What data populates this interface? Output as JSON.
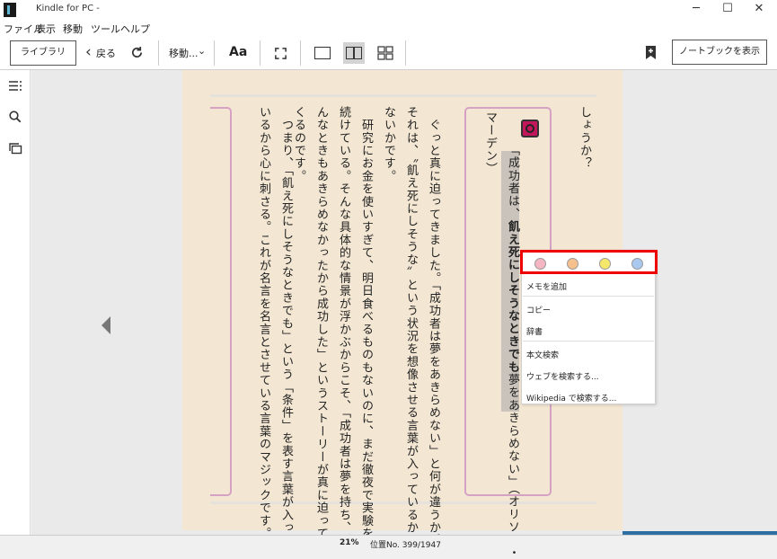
{
  "window": {
    "title": "Kindle for PC -",
    "icon": "kindle-logo-icon",
    "controls": [
      "─",
      "☐",
      "✕"
    ]
  },
  "menubar": {
    "items": [
      "ファイル",
      "表示",
      "移動",
      "ツール",
      "ヘルプ"
    ]
  },
  "toolbar": {
    "library_label": "ライブラリ",
    "back_label": "戻る",
    "goto_label": "移動...",
    "font_label": "Aa",
    "notebook_label": "ノートブックを表示"
  },
  "book": {
    "col1": "しょうか？",
    "quote_open": "「成功者は、",
    "quote_bold": "飢え死にしそうなときでも",
    "quote_rest": "夢をあきらめない」（オリソン・",
    "col_author": "マーデン）",
    "col2": "　ぐっと真に迫ってきました。「成功者は夢をあきらめない」と何が違うか。",
    "col3": "それは、〝飢え死にしそうな〟という状況を想像させる言葉が入っているかい",
    "col4": "ないかです。",
    "col5": "　研究にお金を使いすぎて、明日食べるものもないのに、まだ徹夜で実験を",
    "col6": "続けている。そんな具体的な情景が浮かぶからこそ、「成功者は夢を持ち、ど",
    "col7": "んなときもあきらめなかったから成功した」というストーリーが真に迫って",
    "col8": "くるのです。",
    "col9": "　つまり、「飢え死にしそうなときでも」という「条件」を表す言葉が入って",
    "col10": "いるから心に刺さる。これが名言を名言とさせている言葉のマジックです。"
  },
  "context_menu": {
    "highlight_colors": [
      "#f4b6c2",
      "#f6bf8e",
      "#f5e76a",
      "#a9c8ef"
    ],
    "items": [
      "メモを追加",
      "コピー",
      "辞書",
      "本文検索",
      "ウェブを検索する...",
      "Wikipedia で検索する..."
    ]
  },
  "status": {
    "percent": "21%",
    "location": "位置No. 399/1947",
    "progress": 0.21
  }
}
